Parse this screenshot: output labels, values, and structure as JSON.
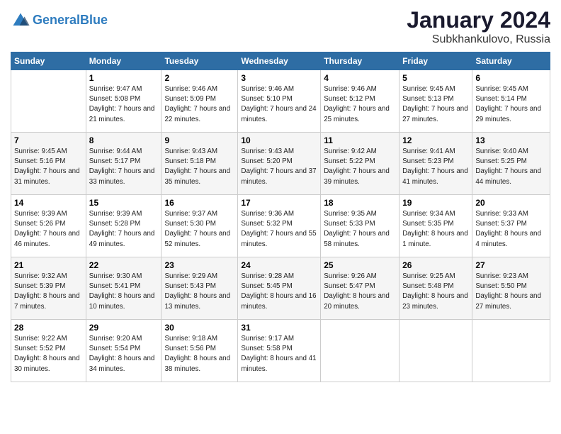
{
  "header": {
    "logo_line1": "General",
    "logo_line2": "Blue",
    "month": "January 2024",
    "location": "Subkhankulovo, Russia"
  },
  "weekdays": [
    "Sunday",
    "Monday",
    "Tuesday",
    "Wednesday",
    "Thursday",
    "Friday",
    "Saturday"
  ],
  "weeks": [
    [
      {
        "day": "",
        "sunrise": "",
        "sunset": "",
        "daylight": ""
      },
      {
        "day": "1",
        "sunrise": "Sunrise: 9:47 AM",
        "sunset": "Sunset: 5:08 PM",
        "daylight": "Daylight: 7 hours and 21 minutes."
      },
      {
        "day": "2",
        "sunrise": "Sunrise: 9:46 AM",
        "sunset": "Sunset: 5:09 PM",
        "daylight": "Daylight: 7 hours and 22 minutes."
      },
      {
        "day": "3",
        "sunrise": "Sunrise: 9:46 AM",
        "sunset": "Sunset: 5:10 PM",
        "daylight": "Daylight: 7 hours and 24 minutes."
      },
      {
        "day": "4",
        "sunrise": "Sunrise: 9:46 AM",
        "sunset": "Sunset: 5:12 PM",
        "daylight": "Daylight: 7 hours and 25 minutes."
      },
      {
        "day": "5",
        "sunrise": "Sunrise: 9:45 AM",
        "sunset": "Sunset: 5:13 PM",
        "daylight": "Daylight: 7 hours and 27 minutes."
      },
      {
        "day": "6",
        "sunrise": "Sunrise: 9:45 AM",
        "sunset": "Sunset: 5:14 PM",
        "daylight": "Daylight: 7 hours and 29 minutes."
      }
    ],
    [
      {
        "day": "7",
        "sunrise": "Sunrise: 9:45 AM",
        "sunset": "Sunset: 5:16 PM",
        "daylight": "Daylight: 7 hours and 31 minutes."
      },
      {
        "day": "8",
        "sunrise": "Sunrise: 9:44 AM",
        "sunset": "Sunset: 5:17 PM",
        "daylight": "Daylight: 7 hours and 33 minutes."
      },
      {
        "day": "9",
        "sunrise": "Sunrise: 9:43 AM",
        "sunset": "Sunset: 5:18 PM",
        "daylight": "Daylight: 7 hours and 35 minutes."
      },
      {
        "day": "10",
        "sunrise": "Sunrise: 9:43 AM",
        "sunset": "Sunset: 5:20 PM",
        "daylight": "Daylight: 7 hours and 37 minutes."
      },
      {
        "day": "11",
        "sunrise": "Sunrise: 9:42 AM",
        "sunset": "Sunset: 5:22 PM",
        "daylight": "Daylight: 7 hours and 39 minutes."
      },
      {
        "day": "12",
        "sunrise": "Sunrise: 9:41 AM",
        "sunset": "Sunset: 5:23 PM",
        "daylight": "Daylight: 7 hours and 41 minutes."
      },
      {
        "day": "13",
        "sunrise": "Sunrise: 9:40 AM",
        "sunset": "Sunset: 5:25 PM",
        "daylight": "Daylight: 7 hours and 44 minutes."
      }
    ],
    [
      {
        "day": "14",
        "sunrise": "Sunrise: 9:39 AM",
        "sunset": "Sunset: 5:26 PM",
        "daylight": "Daylight: 7 hours and 46 minutes."
      },
      {
        "day": "15",
        "sunrise": "Sunrise: 9:39 AM",
        "sunset": "Sunset: 5:28 PM",
        "daylight": "Daylight: 7 hours and 49 minutes."
      },
      {
        "day": "16",
        "sunrise": "Sunrise: 9:37 AM",
        "sunset": "Sunset: 5:30 PM",
        "daylight": "Daylight: 7 hours and 52 minutes."
      },
      {
        "day": "17",
        "sunrise": "Sunrise: 9:36 AM",
        "sunset": "Sunset: 5:32 PM",
        "daylight": "Daylight: 7 hours and 55 minutes."
      },
      {
        "day": "18",
        "sunrise": "Sunrise: 9:35 AM",
        "sunset": "Sunset: 5:33 PM",
        "daylight": "Daylight: 7 hours and 58 minutes."
      },
      {
        "day": "19",
        "sunrise": "Sunrise: 9:34 AM",
        "sunset": "Sunset: 5:35 PM",
        "daylight": "Daylight: 8 hours and 1 minute."
      },
      {
        "day": "20",
        "sunrise": "Sunrise: 9:33 AM",
        "sunset": "Sunset: 5:37 PM",
        "daylight": "Daylight: 8 hours and 4 minutes."
      }
    ],
    [
      {
        "day": "21",
        "sunrise": "Sunrise: 9:32 AM",
        "sunset": "Sunset: 5:39 PM",
        "daylight": "Daylight: 8 hours and 7 minutes."
      },
      {
        "day": "22",
        "sunrise": "Sunrise: 9:30 AM",
        "sunset": "Sunset: 5:41 PM",
        "daylight": "Daylight: 8 hours and 10 minutes."
      },
      {
        "day": "23",
        "sunrise": "Sunrise: 9:29 AM",
        "sunset": "Sunset: 5:43 PM",
        "daylight": "Daylight: 8 hours and 13 minutes."
      },
      {
        "day": "24",
        "sunrise": "Sunrise: 9:28 AM",
        "sunset": "Sunset: 5:45 PM",
        "daylight": "Daylight: 8 hours and 16 minutes."
      },
      {
        "day": "25",
        "sunrise": "Sunrise: 9:26 AM",
        "sunset": "Sunset: 5:47 PM",
        "daylight": "Daylight: 8 hours and 20 minutes."
      },
      {
        "day": "26",
        "sunrise": "Sunrise: 9:25 AM",
        "sunset": "Sunset: 5:48 PM",
        "daylight": "Daylight: 8 hours and 23 minutes."
      },
      {
        "day": "27",
        "sunrise": "Sunrise: 9:23 AM",
        "sunset": "Sunset: 5:50 PM",
        "daylight": "Daylight: 8 hours and 27 minutes."
      }
    ],
    [
      {
        "day": "28",
        "sunrise": "Sunrise: 9:22 AM",
        "sunset": "Sunset: 5:52 PM",
        "daylight": "Daylight: 8 hours and 30 minutes."
      },
      {
        "day": "29",
        "sunrise": "Sunrise: 9:20 AM",
        "sunset": "Sunset: 5:54 PM",
        "daylight": "Daylight: 8 hours and 34 minutes."
      },
      {
        "day": "30",
        "sunrise": "Sunrise: 9:18 AM",
        "sunset": "Sunset: 5:56 PM",
        "daylight": "Daylight: 8 hours and 38 minutes."
      },
      {
        "day": "31",
        "sunrise": "Sunrise: 9:17 AM",
        "sunset": "Sunset: 5:58 PM",
        "daylight": "Daylight: 8 hours and 41 minutes."
      },
      {
        "day": "",
        "sunrise": "",
        "sunset": "",
        "daylight": ""
      },
      {
        "day": "",
        "sunrise": "",
        "sunset": "",
        "daylight": ""
      },
      {
        "day": "",
        "sunrise": "",
        "sunset": "",
        "daylight": ""
      }
    ]
  ]
}
